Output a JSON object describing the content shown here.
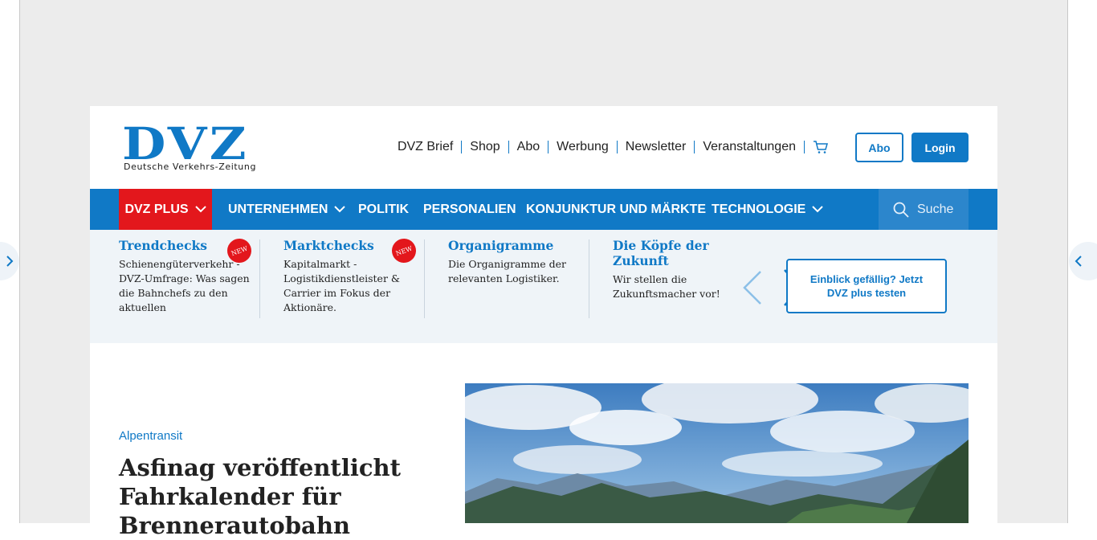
{
  "header": {
    "logo_mark": "DVZ",
    "logo_tagline": "Deutsche Verkehrs-Zeitung",
    "top_links": [
      "DVZ Brief",
      "Shop",
      "Abo",
      "Werbung",
      "Newsletter",
      "Veranstaltungen"
    ],
    "abo_label": "Abo",
    "login_label": "Login"
  },
  "nav": {
    "items": [
      "DVZ PLUS",
      "UNTERNEHMEN",
      "POLITIK",
      "PERSONALIEN",
      "KONJUNKTUR UND MÄRKTE",
      "TECHNOLOGIE"
    ],
    "search_label": "Suche"
  },
  "panel": {
    "cards": [
      {
        "title": "Trendchecks",
        "text": "Schienengüterverkehr - DVZ-Umfrage: Was sagen die Bahnchefs zu den aktuellen",
        "badge": "NEW"
      },
      {
        "title": "Marktchecks",
        "text": "Kapitalmarkt - Logistikdienstleister & Carrier im Fokus der Aktionäre.",
        "badge": "NEW"
      },
      {
        "title": "Organigramme",
        "text": "Die Organigramme der relevanten Logistiker."
      },
      {
        "title": "Die Köpfe der Zukunft",
        "text": "Wir stellen die Zukunftsmacher vor!"
      }
    ],
    "promo_label": "Einblick gefällig? Jetzt DVZ plus testen"
  },
  "article": {
    "kicker": "Alpentransit",
    "headline": "Asfinag veröffentlicht Fahrkalender für Brennerautobahn"
  },
  "colors": {
    "brand_blue": "#1079c6",
    "plus_red": "#e3171c",
    "panel_bg": "#eff4f8",
    "page_bg": "#ececec"
  }
}
